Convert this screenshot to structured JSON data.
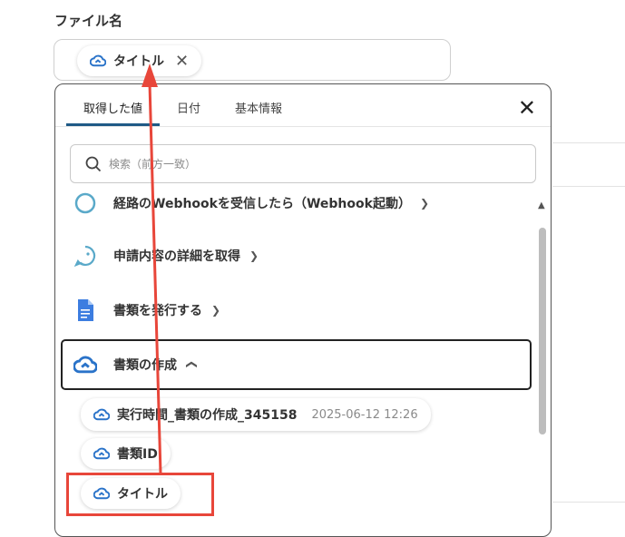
{
  "field": {
    "label": "ファイル名"
  },
  "selected_chip": {
    "label": "タイトル"
  },
  "panel": {
    "tabs": [
      {
        "label": "取得した値",
        "active": true
      },
      {
        "label": "日付",
        "active": false
      },
      {
        "label": "基本情報",
        "active": false
      }
    ],
    "search": {
      "placeholder": "検索（前方一致）"
    },
    "sections": [
      {
        "label": "経路のWebhookを受信したら（Webhook起動）",
        "icon": "webhook-icon",
        "expanded": false
      },
      {
        "label": "申請内容の詳細を取得",
        "icon": "chat-bubble-icon",
        "expanded": false
      },
      {
        "label": "書類を発行する",
        "icon": "google-docs-icon",
        "expanded": false
      },
      {
        "label": "書類の作成",
        "icon": "cloud-sign-icon",
        "expanded": true
      }
    ],
    "values": [
      {
        "label": "実行時間_書類の作成_345158",
        "timestamp": "2025-06-12 12:26"
      },
      {
        "label": "書類ID",
        "timestamp": ""
      },
      {
        "label": "タイトル",
        "timestamp": ""
      }
    ]
  },
  "colors": {
    "accent": "#1f5a86",
    "cloud_icon": "#2a73c9",
    "annotation_red": "#e8463a",
    "docs_blue": "#3c7de0",
    "webhook_teal": "#5aa9c9"
  }
}
